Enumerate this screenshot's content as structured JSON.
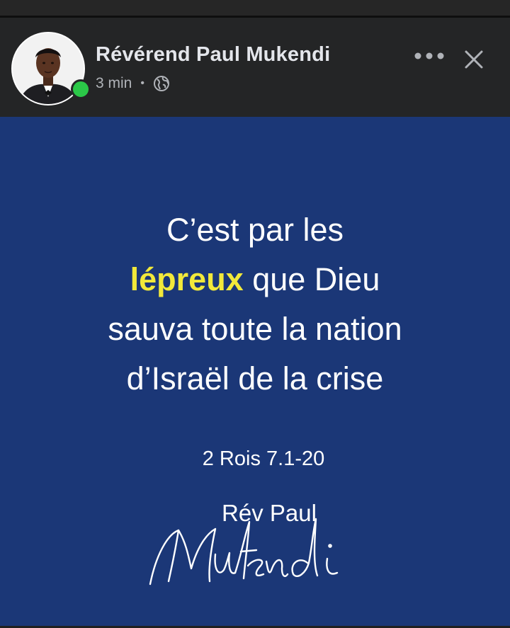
{
  "post": {
    "author_name": "Révérend Paul Mukendi",
    "timestamp": "3 min",
    "separator": "•",
    "privacy_icon": "globe-icon",
    "more_icon": "ellipsis-icon",
    "close_icon": "close-icon",
    "online_status_color": "#2bc848"
  },
  "image": {
    "background_color": "#1b3777",
    "highlight_color": "#f2e93a",
    "quote_line1": "C’est par les",
    "quote_highlight": "lépreux",
    "quote_line2_rest": " que Dieu",
    "quote_line3": "sauva toute la nation",
    "quote_line4": "d’Israël de la crise",
    "reference": "2 Rois 7.1-20",
    "signature_top": "Rév Paul",
    "signature_script": "Mukendi"
  }
}
